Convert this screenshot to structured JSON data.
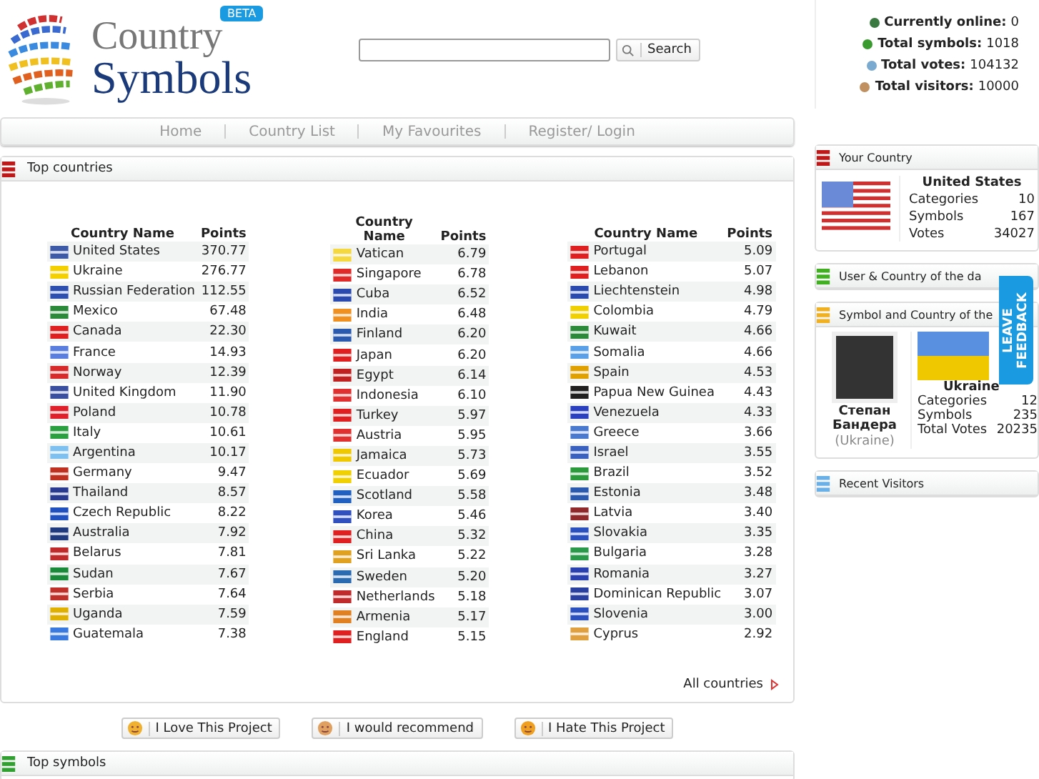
{
  "logo": {
    "line_1": "Country",
    "line_2": "Symbols",
    "badge": "BETA"
  },
  "search": {
    "button": "Search"
  },
  "stats": [
    {
      "kind": "online",
      "label": "Currently online:",
      "value": "0"
    },
    {
      "kind": "symbols",
      "label": "Total symbols:",
      "value": "1018"
    },
    {
      "kind": "votes",
      "label": "Total votes:",
      "value": "104132"
    },
    {
      "kind": "visitors",
      "label": "Total visitors:",
      "value": "10000"
    }
  ],
  "nav": [
    "Home",
    "Country List",
    "My Favourites",
    "Register/ Login"
  ],
  "top_countries": {
    "title": "Top countries",
    "link": "All countries",
    "tables": [
      {
        "headers": [
          "Country Name",
          "Points"
        ],
        "rows": [
          {
            "name": "United States",
            "points": "370.77",
            "color": "#3c5aa8"
          },
          {
            "name": "Ukraine",
            "points": "276.77",
            "color": "#f5d000"
          },
          {
            "name": "Russian Federation",
            "points": "112.55",
            "color": "#2c4fb0"
          },
          {
            "name": "Mexico",
            "points": "67.48",
            "color": "#2a8a3a"
          },
          {
            "name": "Canada",
            "points": "22.30",
            "color": "#e02020"
          },
          {
            "name": "France",
            "points": "14.93",
            "color": "#5a7ee0"
          },
          {
            "name": "Norway",
            "points": "12.39",
            "color": "#d82a2a"
          },
          {
            "name": "United Kingdom",
            "points": "11.90",
            "color": "#3a4fa0"
          },
          {
            "name": "Poland",
            "points": "10.78",
            "color": "#e0202a"
          },
          {
            "name": "Italy",
            "points": "10.61",
            "color": "#2aa040"
          },
          {
            "name": "Argentina",
            "points": "10.17",
            "color": "#7ec0f0"
          },
          {
            "name": "Germany",
            "points": "9.47",
            "color": "#c03020"
          },
          {
            "name": "Thailand",
            "points": "8.57",
            "color": "#2a3a90"
          },
          {
            "name": "Czech Republic",
            "points": "8.22",
            "color": "#2050c0"
          },
          {
            "name": "Australia",
            "points": "7.92",
            "color": "#203a80"
          },
          {
            "name": "Belarus",
            "points": "7.81",
            "color": "#c02a2a"
          },
          {
            "name": "Sudan",
            "points": "7.67",
            "color": "#1a8a3a"
          },
          {
            "name": "Serbia",
            "points": "7.64",
            "color": "#c0302a"
          },
          {
            "name": "Uganda",
            "points": "7.59",
            "color": "#e0b000"
          },
          {
            "name": "Guatemala",
            "points": "7.38",
            "color": "#3a7ae0"
          }
        ]
      },
      {
        "headers": [
          "Country Name",
          "Points"
        ],
        "rows": [
          {
            "name": "Vatican",
            "points": "6.79",
            "color": "#f5d840"
          },
          {
            "name": "Singapore",
            "points": "6.78",
            "color": "#e02a2a"
          },
          {
            "name": "Cuba",
            "points": "6.52",
            "color": "#2a4ab0"
          },
          {
            "name": "India",
            "points": "6.48",
            "color": "#f09020"
          },
          {
            "name": "Finland",
            "points": "6.20",
            "color": "#2a5ab0"
          },
          {
            "name": "Japan",
            "points": "6.20",
            "color": "#e02020"
          },
          {
            "name": "Egypt",
            "points": "6.14",
            "color": "#c02020"
          },
          {
            "name": "Indonesia",
            "points": "6.10",
            "color": "#e03030"
          },
          {
            "name": "Turkey",
            "points": "5.97",
            "color": "#e02020"
          },
          {
            "name": "Austria",
            "points": "5.95",
            "color": "#e03030"
          },
          {
            "name": "Jamaica",
            "points": "5.73",
            "color": "#f0c800"
          },
          {
            "name": "Ecuador",
            "points": "5.69",
            "color": "#f0d000"
          },
          {
            "name": "Scotland",
            "points": "5.58",
            "color": "#2060c0"
          },
          {
            "name": "Korea",
            "points": "5.46",
            "color": "#3050c0"
          },
          {
            "name": "China",
            "points": "5.32",
            "color": "#e02020"
          },
          {
            "name": "Sri Lanka",
            "points": "5.22",
            "color": "#e0a020"
          },
          {
            "name": "Sweden",
            "points": "5.20",
            "color": "#2a6ab0"
          },
          {
            "name": "Netherlands",
            "points": "5.18",
            "color": "#c02a2a"
          },
          {
            "name": "Armenia",
            "points": "5.17",
            "color": "#e08020"
          },
          {
            "name": "England",
            "points": "5.15",
            "color": "#e02020"
          }
        ]
      },
      {
        "headers": [
          "Country Name",
          "Points"
        ],
        "rows": [
          {
            "name": "Portugal",
            "points": "5.09",
            "color": "#e02020"
          },
          {
            "name": "Lebanon",
            "points": "5.07",
            "color": "#e02020"
          },
          {
            "name": "Liechtenstein",
            "points": "4.98",
            "color": "#2a4ab0"
          },
          {
            "name": "Colombia",
            "points": "4.79",
            "color": "#f0d000"
          },
          {
            "name": "Kuwait",
            "points": "4.66",
            "color": "#2a8a3a"
          },
          {
            "name": "Somalia",
            "points": "4.66",
            "color": "#5aa0e8"
          },
          {
            "name": "Spain",
            "points": "4.53",
            "color": "#e0a000"
          },
          {
            "name": "Papua New Guinea",
            "points": "4.43",
            "color": "#202020"
          },
          {
            "name": "Venezuela",
            "points": "4.33",
            "color": "#2a40c0"
          },
          {
            "name": "Greece",
            "points": "3.66",
            "color": "#4a7ad0"
          },
          {
            "name": "Israel",
            "points": "3.55",
            "color": "#3a60c0"
          },
          {
            "name": "Brazil",
            "points": "3.52",
            "color": "#2a9a3a"
          },
          {
            "name": "Estonia",
            "points": "3.48",
            "color": "#2a5ab0"
          },
          {
            "name": "Latvia",
            "points": "3.40",
            "color": "#902a2a"
          },
          {
            "name": "Slovakia",
            "points": "3.35",
            "color": "#2a50c0"
          },
          {
            "name": "Bulgaria",
            "points": "3.28",
            "color": "#2a9a4a"
          },
          {
            "name": "Romania",
            "points": "3.27",
            "color": "#2a40b0"
          },
          {
            "name": "Dominican Republic",
            "points": "3.07",
            "color": "#2a40a0"
          },
          {
            "name": "Slovenia",
            "points": "3.00",
            "color": "#2a50c0"
          },
          {
            "name": "Cyprus",
            "points": "2.92",
            "color": "#e0a040"
          }
        ]
      }
    ]
  },
  "actions": [
    {
      "kind": "love",
      "label": "I Love This Project"
    },
    {
      "kind": "recommend",
      "label": "I would recommend"
    },
    {
      "kind": "hate",
      "label": "I Hate This Project"
    }
  ],
  "bottom_panel": {
    "title": "Top symbols"
  },
  "your_country": {
    "title": "Your Country",
    "name": "United States",
    "stats": [
      {
        "label": "Categories",
        "value": "10"
      },
      {
        "label": "Symbols",
        "value": "167"
      },
      {
        "label": "Votes",
        "value": "34027"
      }
    ]
  },
  "user_of_day": {
    "title": "User & Country of the da"
  },
  "symbol_of_day": {
    "title": "Symbol and Country of the",
    "person_name": "Степан Бандера",
    "person_country": "(Ukraine)",
    "country": "Ukraine",
    "stats": [
      {
        "label": "Categories",
        "value": "12"
      },
      {
        "label": "Symbols",
        "value": "235"
      },
      {
        "label": "Total Votes",
        "value": "20235"
      }
    ]
  },
  "recent_visitors": {
    "title": "Recent Visitors"
  },
  "feedback_tab": "LEAVE FEEDBACK"
}
